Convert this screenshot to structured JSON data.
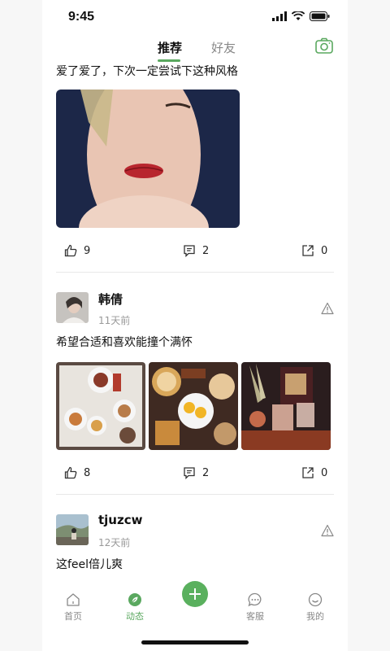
{
  "status": {
    "time": "9:45"
  },
  "header": {
    "tabs": [
      {
        "label": "推荐"
      },
      {
        "label": "好友"
      }
    ]
  },
  "posts": [
    {
      "text": "爱了爱了，下次一定尝试下这种风格",
      "likes": "9",
      "comments": "2",
      "shares": "0"
    },
    {
      "user": "韩倩",
      "time": "11天前",
      "text": "希望合适和喜欢能撞个满怀",
      "likes": "8",
      "comments": "2",
      "shares": "0"
    },
    {
      "user": "tjuzcw",
      "time": "12天前",
      "text": "这feel倍儿爽"
    }
  ],
  "tabbar": {
    "items": [
      {
        "label": "首页"
      },
      {
        "label": "动态"
      },
      {
        "label": "客服"
      },
      {
        "label": "我的"
      }
    ]
  },
  "colors": {
    "accent": "#5aa85f"
  }
}
